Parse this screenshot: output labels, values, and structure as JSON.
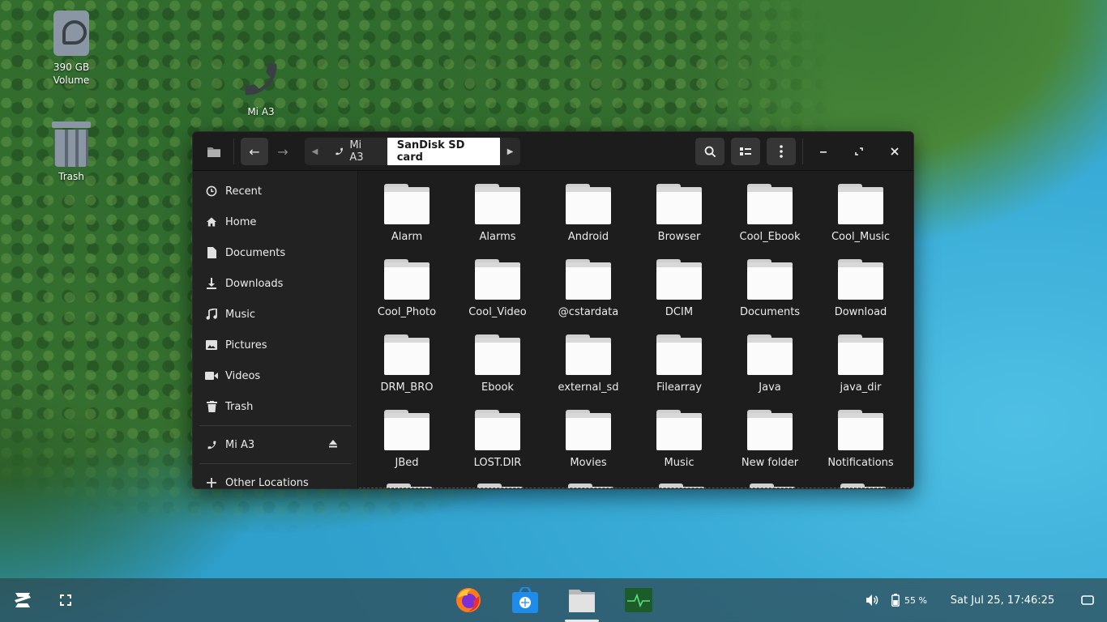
{
  "desktop": {
    "icons": [
      {
        "label_line1": "390 GB",
        "label_line2": "Volume",
        "icon": "drive-icon"
      },
      {
        "label": "Mi A3",
        "icon": "phone-icon"
      },
      {
        "label": "Trash",
        "icon": "trash-icon"
      }
    ]
  },
  "window": {
    "headerbar": {
      "path": [
        {
          "label": "Mi A3",
          "icon": "phone-icon"
        },
        {
          "label": "SanDisk SD card",
          "active": true
        }
      ],
      "buttons": [
        "app-icon",
        "back-icon",
        "forward-icon",
        "search-icon",
        "view-list-icon",
        "menu-icon",
        "minimize-icon",
        "maximize-icon",
        "close-icon"
      ]
    },
    "sidebar": {
      "places": [
        {
          "label": "Recent",
          "icon": "clock-icon"
        },
        {
          "label": "Home",
          "icon": "home-icon"
        },
        {
          "label": "Documents",
          "icon": "document-icon"
        },
        {
          "label": "Downloads",
          "icon": "download-icon"
        },
        {
          "label": "Music",
          "icon": "music-icon"
        },
        {
          "label": "Pictures",
          "icon": "picture-icon"
        },
        {
          "label": "Videos",
          "icon": "video-icon"
        },
        {
          "label": "Trash",
          "icon": "trash-icon"
        }
      ],
      "devices": [
        {
          "label": "Mi A3",
          "icon": "phone-icon"
        }
      ],
      "other": {
        "label": "Other Locations",
        "icon": "plus-icon"
      }
    },
    "files": [
      "Alarm",
      "Alarms",
      "Android",
      "Browser",
      "Cool_Ebook",
      "Cool_Music",
      "Cool_Photo",
      "Cool_Video",
      "@cstardata",
      "DCIM",
      "Documents",
      "Download",
      "DRM_BRO",
      "Ebook",
      "external_sd",
      "Filearray",
      "Java",
      "java_dir",
      "JBed",
      "LOST.DIR",
      "Movies",
      "Music",
      "New folder",
      "Notifications"
    ]
  },
  "taskbar": {
    "apps": [
      {
        "name": "Firefox",
        "icon": "firefox-icon"
      },
      {
        "name": "Software",
        "icon": "software-store-icon"
      },
      {
        "name": "Files",
        "icon": "files-icon",
        "active": true
      },
      {
        "name": "System Monitor",
        "icon": "system-monitor-icon"
      }
    ],
    "battery": "55 %",
    "clock": "Sat Jul 25, 17:46:25"
  }
}
